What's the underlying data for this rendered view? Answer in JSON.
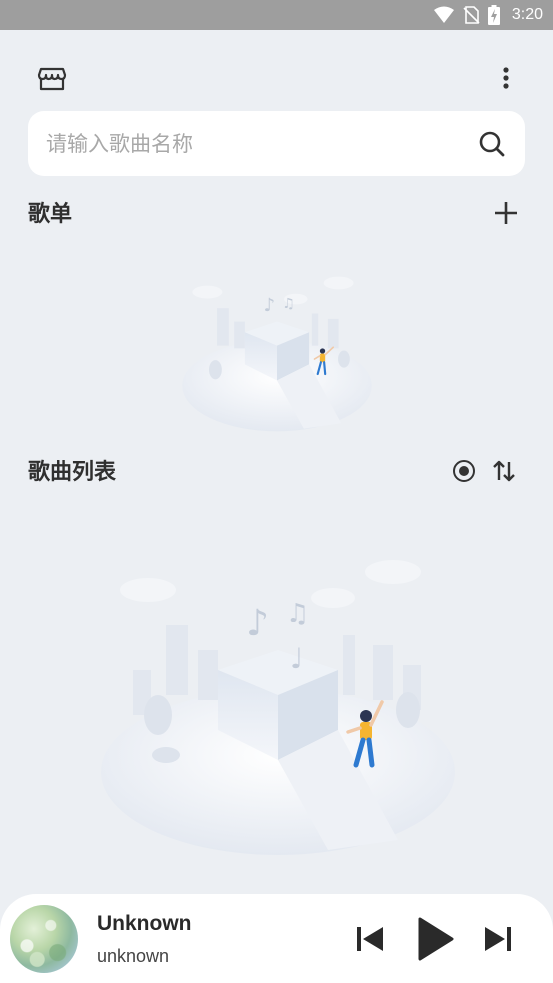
{
  "status_bar": {
    "time": "3:20",
    "icons": [
      "wifi-icon",
      "no-sim-icon",
      "battery-charging-icon"
    ]
  },
  "toolbar": {
    "left_icon": "store-icon",
    "right_icon": "more-vert-icon"
  },
  "search": {
    "placeholder": "请输入歌曲名称",
    "value": "",
    "icon": "search-icon"
  },
  "playlist_section": {
    "title": "歌单",
    "action_icon": "add-icon"
  },
  "songlist_section": {
    "title": "歌曲列表",
    "action_icons": [
      "locate-icon",
      "sort-icon"
    ]
  },
  "player": {
    "title": "Unknown",
    "artist": "unknown",
    "controls": [
      "previous-icon",
      "play-icon",
      "next-icon"
    ]
  },
  "colors": {
    "background": "#eceff3",
    "status_bar": "#9e9e9e",
    "card": "#ffffff",
    "text_primary": "#2f2f2f",
    "placeholder": "#a8a8a8"
  }
}
